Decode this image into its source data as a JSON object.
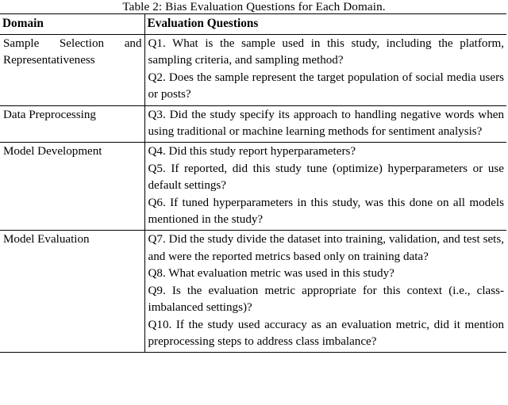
{
  "caption": "Table 2: Bias Evaluation Questions for Each Domain.",
  "table": {
    "columns": [
      {
        "key": "domain",
        "header": "Domain"
      },
      {
        "key": "questions",
        "header": "Evaluation Questions"
      }
    ],
    "rows": [
      {
        "domain": "Sample Selection and Representativeness",
        "questions": [
          "Q1. What is the sample used in this study, including the platform, sampling criteria, and sampling method?",
          "Q2. Does the sample represent the target population of social media users or posts?"
        ]
      },
      {
        "domain": "Data Preprocessing",
        "questions": [
          "Q3. Did the study specify its approach to handling negative words when using traditional or machine learning methods for sentiment analysis?"
        ]
      },
      {
        "domain": "Model Development",
        "questions": [
          "Q4. Did this study report hyperparameters?",
          "Q5. If reported, did this study tune (optimize) hyperparameters or use default settings?",
          "Q6. If tuned hyperparameters in this study, was this done on all models mentioned in the study?"
        ]
      },
      {
        "domain": "Model Evaluation",
        "questions": [
          "Q7. Did the study divide the dataset into training, validation, and test sets, and were the reported metrics based only on training data?",
          "Q8. What evaluation metric was used in this study?",
          "Q9. Is the evaluation metric appropriate for this context (i.e., class-imbalanced settings)?",
          "Q10. If the study used accuracy as an evaluation metric, did it mention preprocessing steps to address class imbalance?"
        ]
      }
    ]
  },
  "colors": {
    "text": "#000000",
    "rule": "#000000",
    "background": "#ffffff"
  }
}
